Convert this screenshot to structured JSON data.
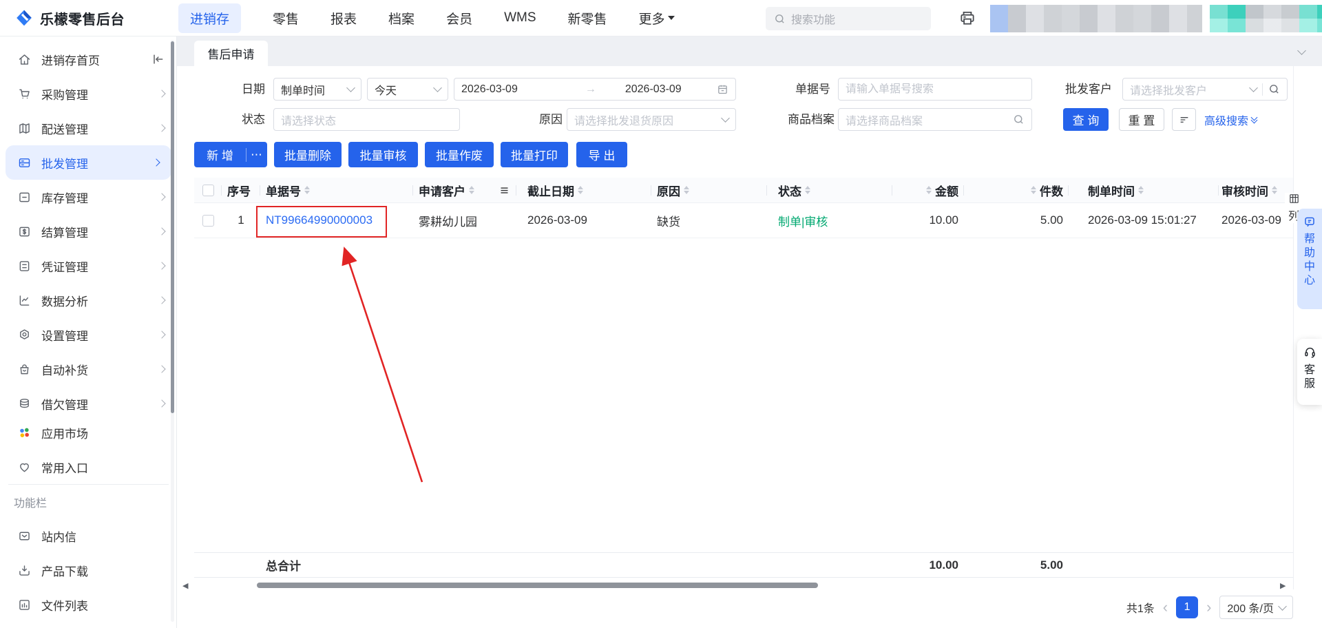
{
  "app": {
    "title": "乐檬零售后台"
  },
  "topnav": {
    "items": [
      "进销存",
      "零售",
      "报表",
      "档案",
      "会员",
      "WMS",
      "新零售",
      "更多"
    ],
    "active": "进销存",
    "search_placeholder": "搜索功能"
  },
  "sidebar": {
    "items": [
      {
        "label": "进销存首页"
      },
      {
        "label": "采购管理"
      },
      {
        "label": "配送管理"
      },
      {
        "label": "批发管理"
      },
      {
        "label": "库存管理"
      },
      {
        "label": "结算管理"
      },
      {
        "label": "凭证管理"
      },
      {
        "label": "数据分析"
      },
      {
        "label": "设置管理"
      },
      {
        "label": "自动补货"
      },
      {
        "label": "借欠管理"
      }
    ],
    "active": "批发管理",
    "apps": [
      {
        "label": "应用市场"
      },
      {
        "label": "常用入口"
      }
    ],
    "section_label": "功能栏",
    "tools": [
      {
        "label": "站内信"
      },
      {
        "label": "产品下载"
      },
      {
        "label": "文件列表"
      }
    ]
  },
  "page": {
    "tab": "售后申请",
    "filters": {
      "date_label": "日期",
      "date_type": "制单时间",
      "date_preset": "今天",
      "date_from": "2026-03-09",
      "date_to": "2026-03-09",
      "doc_no_label": "单据号",
      "doc_no_placeholder": "请输入单据号搜索",
      "customer_label": "批发客户",
      "customer_placeholder": "请选择批发客户",
      "status_label": "状态",
      "status_placeholder": "请选择状态",
      "reason_label": "原因",
      "reason_placeholder": "请选择批发退货原因",
      "product_label": "商品档案",
      "product_placeholder": "请选择商品档案",
      "search_btn": "查 询",
      "reset_btn": "重 置",
      "advanced": "高级搜索"
    },
    "actions": {
      "add": "新 增",
      "more": "⋯",
      "batch_delete": "批量删除",
      "batch_audit": "批量审核",
      "batch_void": "批量作废",
      "batch_print": "批量打印",
      "export": "导 出"
    },
    "table": {
      "columns": [
        "序号",
        "单据号",
        "申请客户",
        "截止日期",
        "原因",
        "状态",
        "金额",
        "件数",
        "制单时间",
        "审核时间"
      ],
      "rows": [
        {
          "no": "1",
          "doc_no": "NT99664990000003",
          "customer": "雾耕幼儿园",
          "deadline": "2026-03-09",
          "reason": "缺货",
          "status": "制单|审核",
          "amount": "10.00",
          "qty": "5.00",
          "created_at": "2026-03-09 15:01:27",
          "audited_at": "2026-03-09"
        }
      ],
      "total_label": "总合计",
      "total_amount": "10.00",
      "total_qty": "5.00",
      "column_tool": "列"
    },
    "pagination": {
      "total": "共1条",
      "page": "1",
      "page_size": "200 条/页"
    },
    "widgets": {
      "help": "帮助中心",
      "service": "客服"
    }
  },
  "colors": {
    "primary": "#2563eb",
    "status_green": "#00a870",
    "annotation_red": "#e12424",
    "redacted_teal": "#3fd9c4"
  }
}
